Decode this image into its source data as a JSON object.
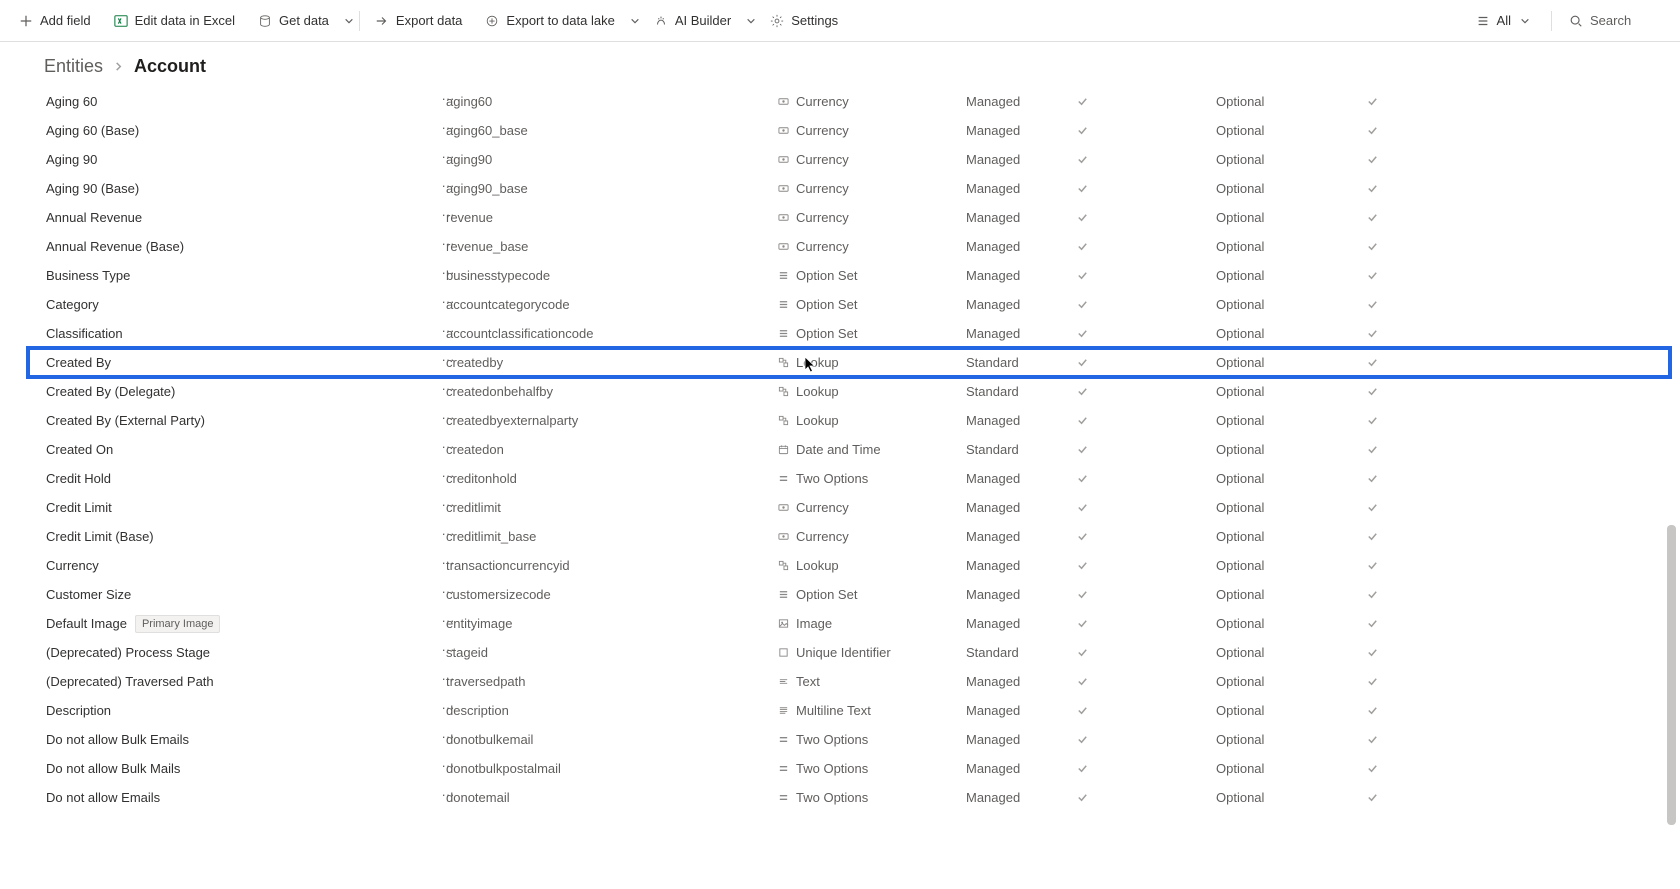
{
  "toolbar": {
    "add_field": "Add field",
    "edit_excel": "Edit data in Excel",
    "get_data": "Get data",
    "export_data": "Export data",
    "export_lake": "Export to data lake",
    "ai_builder": "AI Builder",
    "settings": "Settings",
    "all_filter": "All",
    "search_placeholder": "Search"
  },
  "breadcrumb": {
    "parent": "Entities",
    "current": "Account"
  },
  "highlightIndex": 9,
  "rows": [
    {
      "display": "Aging 60",
      "name": "aging60",
      "type": "Currency",
      "kind": "Managed",
      "req": "Optional"
    },
    {
      "display": "Aging 60 (Base)",
      "name": "aging60_base",
      "type": "Currency",
      "kind": "Managed",
      "req": "Optional"
    },
    {
      "display": "Aging 90",
      "name": "aging90",
      "type": "Currency",
      "kind": "Managed",
      "req": "Optional"
    },
    {
      "display": "Aging 90 (Base)",
      "name": "aging90_base",
      "type": "Currency",
      "kind": "Managed",
      "req": "Optional"
    },
    {
      "display": "Annual Revenue",
      "name": "revenue",
      "type": "Currency",
      "kind": "Managed",
      "req": "Optional"
    },
    {
      "display": "Annual Revenue (Base)",
      "name": "revenue_base",
      "type": "Currency",
      "kind": "Managed",
      "req": "Optional"
    },
    {
      "display": "Business Type",
      "name": "businesstypecode",
      "type": "Option Set",
      "kind": "Managed",
      "req": "Optional"
    },
    {
      "display": "Category",
      "name": "accountcategorycode",
      "type": "Option Set",
      "kind": "Managed",
      "req": "Optional"
    },
    {
      "display": "Classification",
      "name": "accountclassificationcode",
      "type": "Option Set",
      "kind": "Managed",
      "req": "Optional"
    },
    {
      "display": "Created By",
      "name": "createdby",
      "type": "Lookup",
      "kind": "Standard",
      "req": "Optional"
    },
    {
      "display": "Created By (Delegate)",
      "name": "createdonbehalfby",
      "type": "Lookup",
      "kind": "Standard",
      "req": "Optional"
    },
    {
      "display": "Created By (External Party)",
      "name": "createdbyexternalparty",
      "type": "Lookup",
      "kind": "Managed",
      "req": "Optional"
    },
    {
      "display": "Created On",
      "name": "createdon",
      "type": "Date and Time",
      "kind": "Standard",
      "req": "Optional"
    },
    {
      "display": "Credit Hold",
      "name": "creditonhold",
      "type": "Two Options",
      "kind": "Managed",
      "req": "Optional"
    },
    {
      "display": "Credit Limit",
      "name": "creditlimit",
      "type": "Currency",
      "kind": "Managed",
      "req": "Optional"
    },
    {
      "display": "Credit Limit (Base)",
      "name": "creditlimit_base",
      "type": "Currency",
      "kind": "Managed",
      "req": "Optional"
    },
    {
      "display": "Currency",
      "name": "transactioncurrencyid",
      "type": "Lookup",
      "kind": "Managed",
      "req": "Optional"
    },
    {
      "display": "Customer Size",
      "name": "customersizecode",
      "type": "Option Set",
      "kind": "Managed",
      "req": "Optional"
    },
    {
      "display": "Default Image",
      "badge": "Primary Image",
      "name": "entityimage",
      "type": "Image",
      "kind": "Managed",
      "req": "Optional"
    },
    {
      "display": "(Deprecated) Process Stage",
      "name": "stageid",
      "type": "Unique Identifier",
      "kind": "Standard",
      "req": "Optional"
    },
    {
      "display": "(Deprecated) Traversed Path",
      "name": "traversedpath",
      "type": "Text",
      "kind": "Managed",
      "req": "Optional"
    },
    {
      "display": "Description",
      "name": "description",
      "type": "Multiline Text",
      "kind": "Managed",
      "req": "Optional"
    },
    {
      "display": "Do not allow Bulk Emails",
      "name": "donotbulkemail",
      "type": "Two Options",
      "kind": "Managed",
      "req": "Optional"
    },
    {
      "display": "Do not allow Bulk Mails",
      "name": "donotbulkpostalmail",
      "type": "Two Options",
      "kind": "Managed",
      "req": "Optional"
    },
    {
      "display": "Do not allow Emails",
      "name": "donotemail",
      "type": "Two Options",
      "kind": "Managed",
      "req": "Optional"
    }
  ]
}
